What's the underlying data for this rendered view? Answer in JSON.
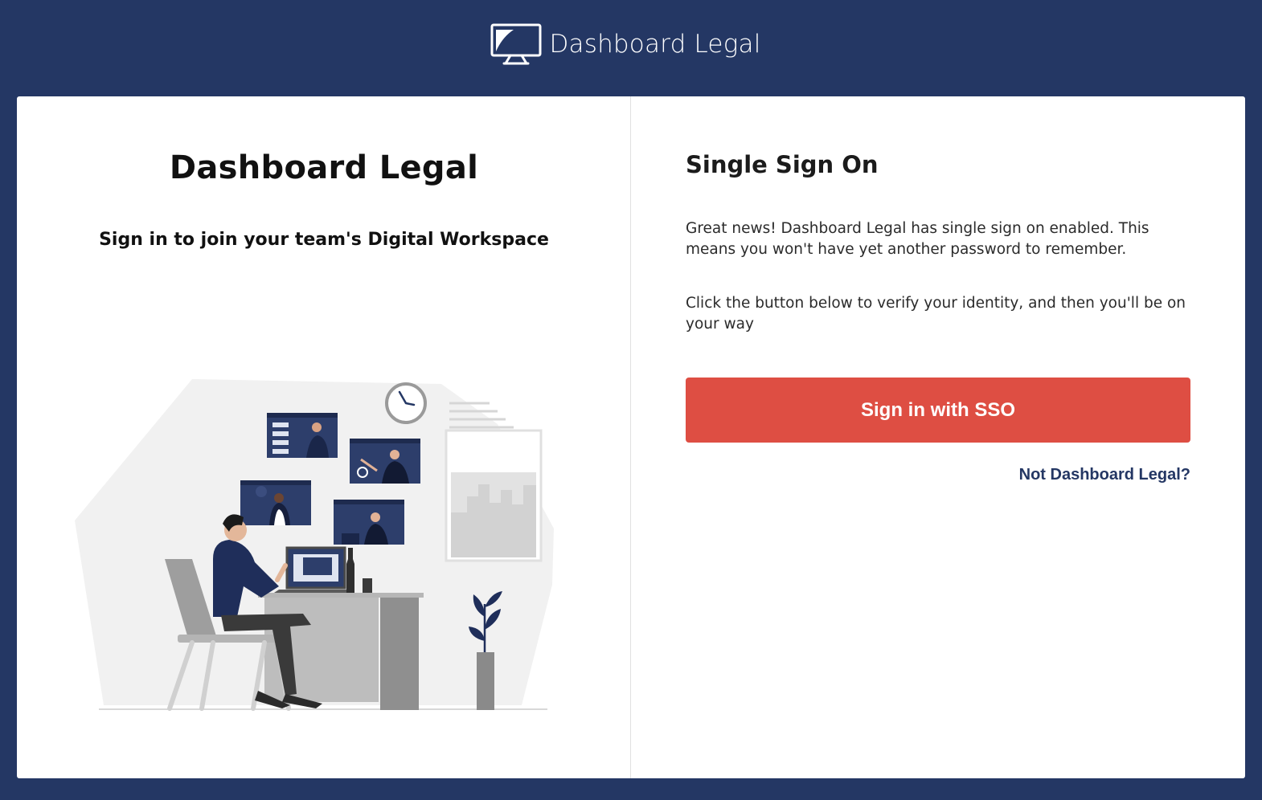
{
  "header": {
    "brand_name": "Dashboard Legal",
    "brand_icon": "monitor-logo-icon"
  },
  "left_panel": {
    "title": "Dashboard Legal",
    "subtitle": "Sign in to join your team's Digital Workspace",
    "illustration": "remote-work-video-call-illustration"
  },
  "right_panel": {
    "title": "Single Sign On",
    "paragraph_1": "Great news! Dashboard Legal has single sign on enabled. This means you won't have yet another password to remember.",
    "paragraph_2": "Click the button below to verify your identity, and then you'll be on your way",
    "sso_button_label": "Sign in with SSO",
    "not_org_link": "Not Dashboard Legal?"
  },
  "colors": {
    "background": "#243764",
    "card": "#ffffff",
    "button": "#de4e43",
    "link": "#243764"
  }
}
